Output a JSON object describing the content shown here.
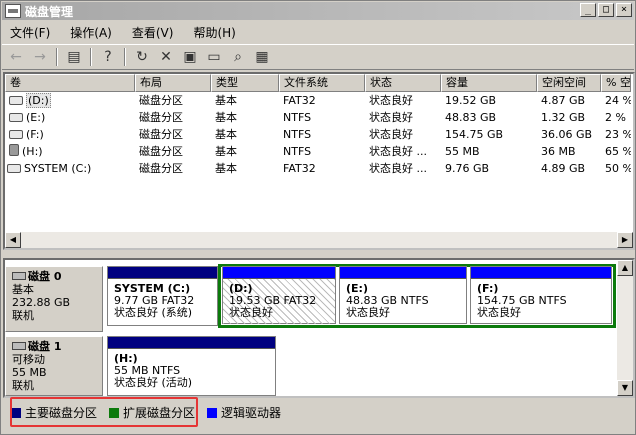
{
  "window": {
    "title": "磁盘管理",
    "min": "_",
    "max": "□",
    "close": "×"
  },
  "menu": [
    "文件(F)",
    "操作(A)",
    "查看(V)",
    "帮助(H)"
  ],
  "list": {
    "columns": [
      "卷",
      "布局",
      "类型",
      "文件系统",
      "状态",
      "容量",
      "空闲空间",
      "% 空"
    ],
    "rows": [
      {
        "vol": "(D:)",
        "layout": "磁盘分区",
        "type": "基本",
        "fs": "FAT32",
        "status": "状态良好",
        "cap": "19.52 GB",
        "free": "4.87 GB",
        "pct": "24 %"
      },
      {
        "vol": "(E:)",
        "layout": "磁盘分区",
        "type": "基本",
        "fs": "NTFS",
        "status": "状态良好",
        "cap": "48.83 GB",
        "free": "1.32 GB",
        "pct": "2 %"
      },
      {
        "vol": "(F:)",
        "layout": "磁盘分区",
        "type": "基本",
        "fs": "NTFS",
        "status": "状态良好",
        "cap": "154.75 GB",
        "free": "36.06 GB",
        "pct": "23 %"
      },
      {
        "vol": "(H:)",
        "layout": "磁盘分区",
        "type": "基本",
        "fs": "NTFS",
        "status": "状态良好 ...",
        "cap": "55 MB",
        "free": "36 MB",
        "pct": "65 %"
      },
      {
        "vol": "SYSTEM (C:)",
        "layout": "磁盘分区",
        "type": "基本",
        "fs": "FAT32",
        "status": "状态良好 ...",
        "cap": "9.76 GB",
        "free": "4.89 GB",
        "pct": "50 %"
      }
    ]
  },
  "disks": {
    "disk0": {
      "name": "磁盘 0",
      "type": "基本",
      "size": "232.88 GB",
      "state": "联机",
      "parts": [
        {
          "label": "SYSTEM  (C:)",
          "info": "9.77 GB FAT32",
          "status": "状态良好 (系统)"
        },
        {
          "label": "(D:)",
          "info": "19.53 GB FAT32",
          "status": "状态良好"
        },
        {
          "label": "(E:)",
          "info": "48.83 GB NTFS",
          "status": "状态良好"
        },
        {
          "label": "(F:)",
          "info": "154.75 GB NTFS",
          "status": "状态良好"
        }
      ]
    },
    "disk1": {
      "name": "磁盘 1",
      "type": "可移动",
      "size": "55 MB",
      "state": "联机",
      "parts": [
        {
          "label": "(H:)",
          "info": "55 MB NTFS",
          "status": "状态良好 (活动)"
        }
      ]
    }
  },
  "legend": {
    "primary": "主要磁盘分区",
    "extended": "扩展磁盘分区",
    "logical": "逻辑驱动器",
    "colors": {
      "primary": "#000080",
      "extended": "#0c7a0c",
      "logical": "#0000ff"
    }
  }
}
